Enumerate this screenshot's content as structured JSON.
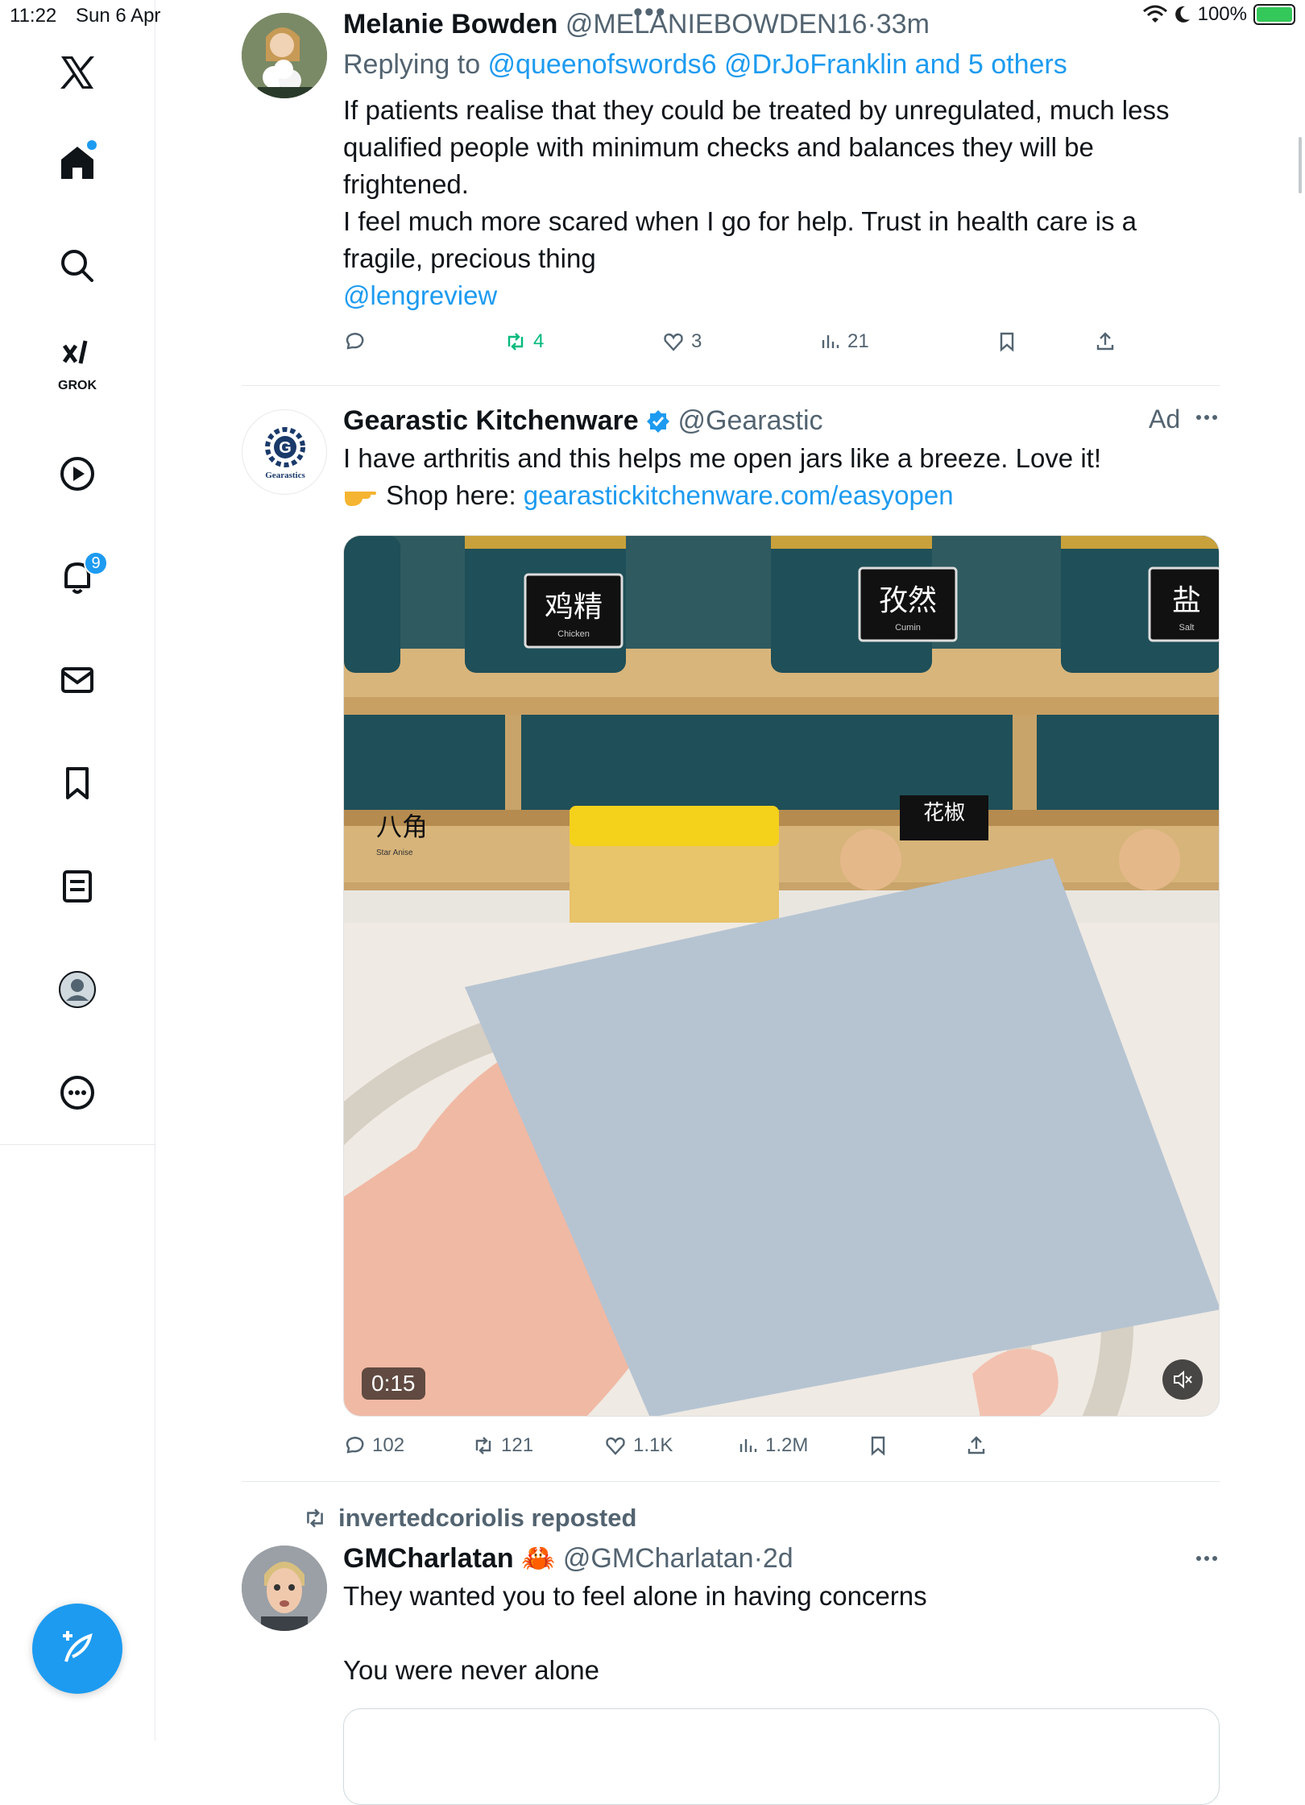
{
  "status_bar": {
    "time": "11:22",
    "date": "Sun 6 Apr",
    "battery": "100%",
    "dots": "•••"
  },
  "sidebar": {
    "items": [
      {
        "icon": "x-logo-icon"
      },
      {
        "icon": "home-icon",
        "has_dot": true
      },
      {
        "icon": "search-icon"
      },
      {
        "icon": "grok-icon",
        "label": "GROK"
      },
      {
        "icon": "video-icon"
      },
      {
        "icon": "notifications-icon",
        "badge": "9"
      },
      {
        "icon": "messages-icon"
      },
      {
        "icon": "bookmarks-icon"
      },
      {
        "icon": "lists-icon"
      },
      {
        "icon": "profile-icon"
      },
      {
        "icon": "more-icon"
      }
    ],
    "compose_icon": "compose-icon"
  },
  "tweets": [
    {
      "name": "Melanie Bowden",
      "handle": "@MELANIEBOWDEN16",
      "time": "33m",
      "replying_prefix": "Replying to ",
      "replying_to": "@queenofswords6 @DrJoFranklin and 5 others",
      "text_lines": [
        "If patients realise that they could be treated by unregulated, much less",
        "qualified people with minimum checks and balances they will be",
        "frightened.",
        "I feel much more scared when I go for help. Trust in health care is a",
        "fragile, precious thing"
      ],
      "mention": "@lengreview",
      "stats": {
        "replies": "",
        "reposts": "4",
        "likes": "3",
        "views": "21"
      }
    },
    {
      "name": "Gearastic Kitchenware",
      "handle": "@Gearastic",
      "ad_label": "Ad",
      "text_line1": "I have arthritis and this helps me open jars like a breeze. Love it!",
      "shop_prefix": "Shop here: ",
      "shop_link": "gearastickitchenware.com/easyopen",
      "avatar_text": "Gearastics",
      "video_duration": "0:15",
      "jar_labels": [
        "鸡精",
        "孜然",
        "盐",
        "八角",
        "花椒"
      ],
      "jar_sublabels": [
        "Chicken",
        "Cumin",
        "Salt",
        "Star Anise"
      ],
      "stats": {
        "replies": "102",
        "reposts": "121",
        "likes": "1.1K",
        "views": "1.2M"
      }
    },
    {
      "repost_by": "invertedcoriolis reposted",
      "name": "GMCharlatan",
      "emoji": "🦀",
      "handle": "@GMCharlatan",
      "time": "2d",
      "text_line1": "They wanted you to feel alone in having concerns",
      "text_line2": "You were never alone"
    }
  ],
  "colors": {
    "accent": "#1d9bf0",
    "repost_green": "#00ba7c",
    "muted": "#536471",
    "divider": "#e6e9eb"
  }
}
